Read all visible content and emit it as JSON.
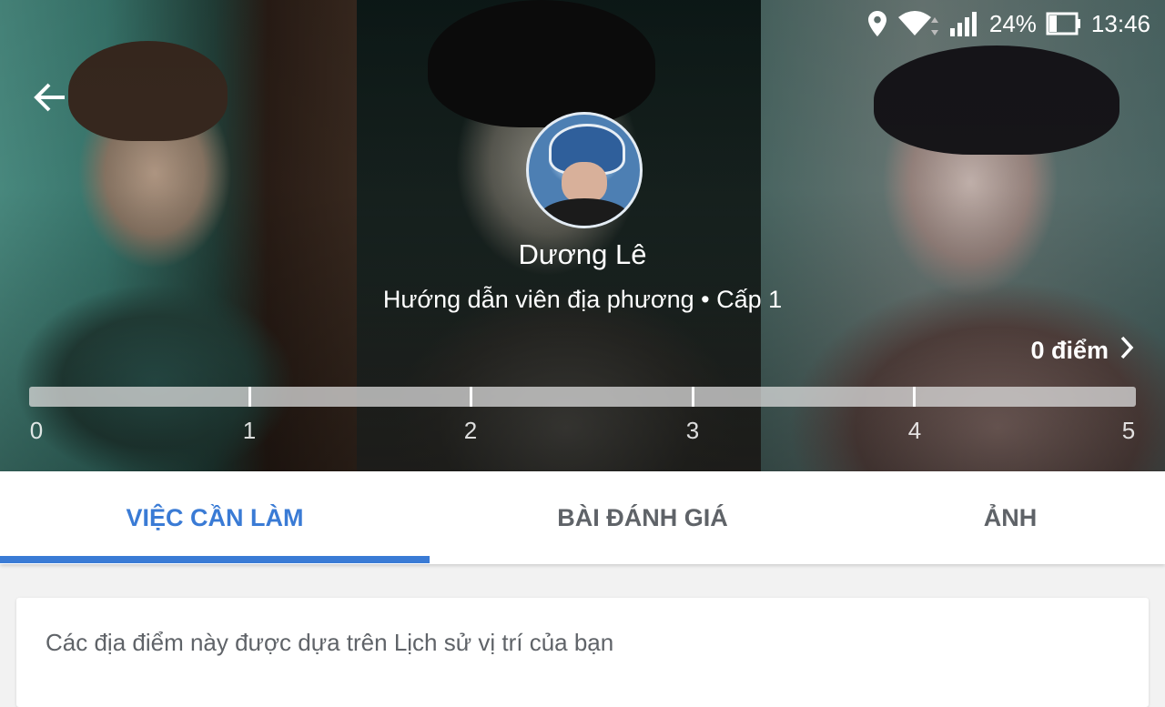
{
  "status_bar": {
    "battery_percent": "24%",
    "time": "13:46",
    "icons": [
      "location-icon",
      "wifi-icon",
      "signal-icon",
      "battery-icon"
    ]
  },
  "header": {
    "back_icon": "arrow-back-icon"
  },
  "profile": {
    "name": "Dương Lê",
    "level_text": "Hướng dẫn viên địa phương • Cấp 1",
    "points_text": "0 điểm",
    "points_icon": "chevron-right-icon"
  },
  "progress": {
    "value": 0,
    "max": 5,
    "tick_labels": [
      "0",
      "1",
      "2",
      "3",
      "4",
      "5"
    ]
  },
  "tabs": [
    {
      "label": "VIỆC CẦN LÀM",
      "active": true
    },
    {
      "label": "BÀI ĐÁNH GIÁ",
      "active": false
    },
    {
      "label": "ẢNH",
      "active": false
    }
  ],
  "content": {
    "card_text": "Các địa điểm này được dựa trên Lịch sử vị trí của bạn"
  },
  "colors": {
    "accent": "#3a7bd5"
  }
}
